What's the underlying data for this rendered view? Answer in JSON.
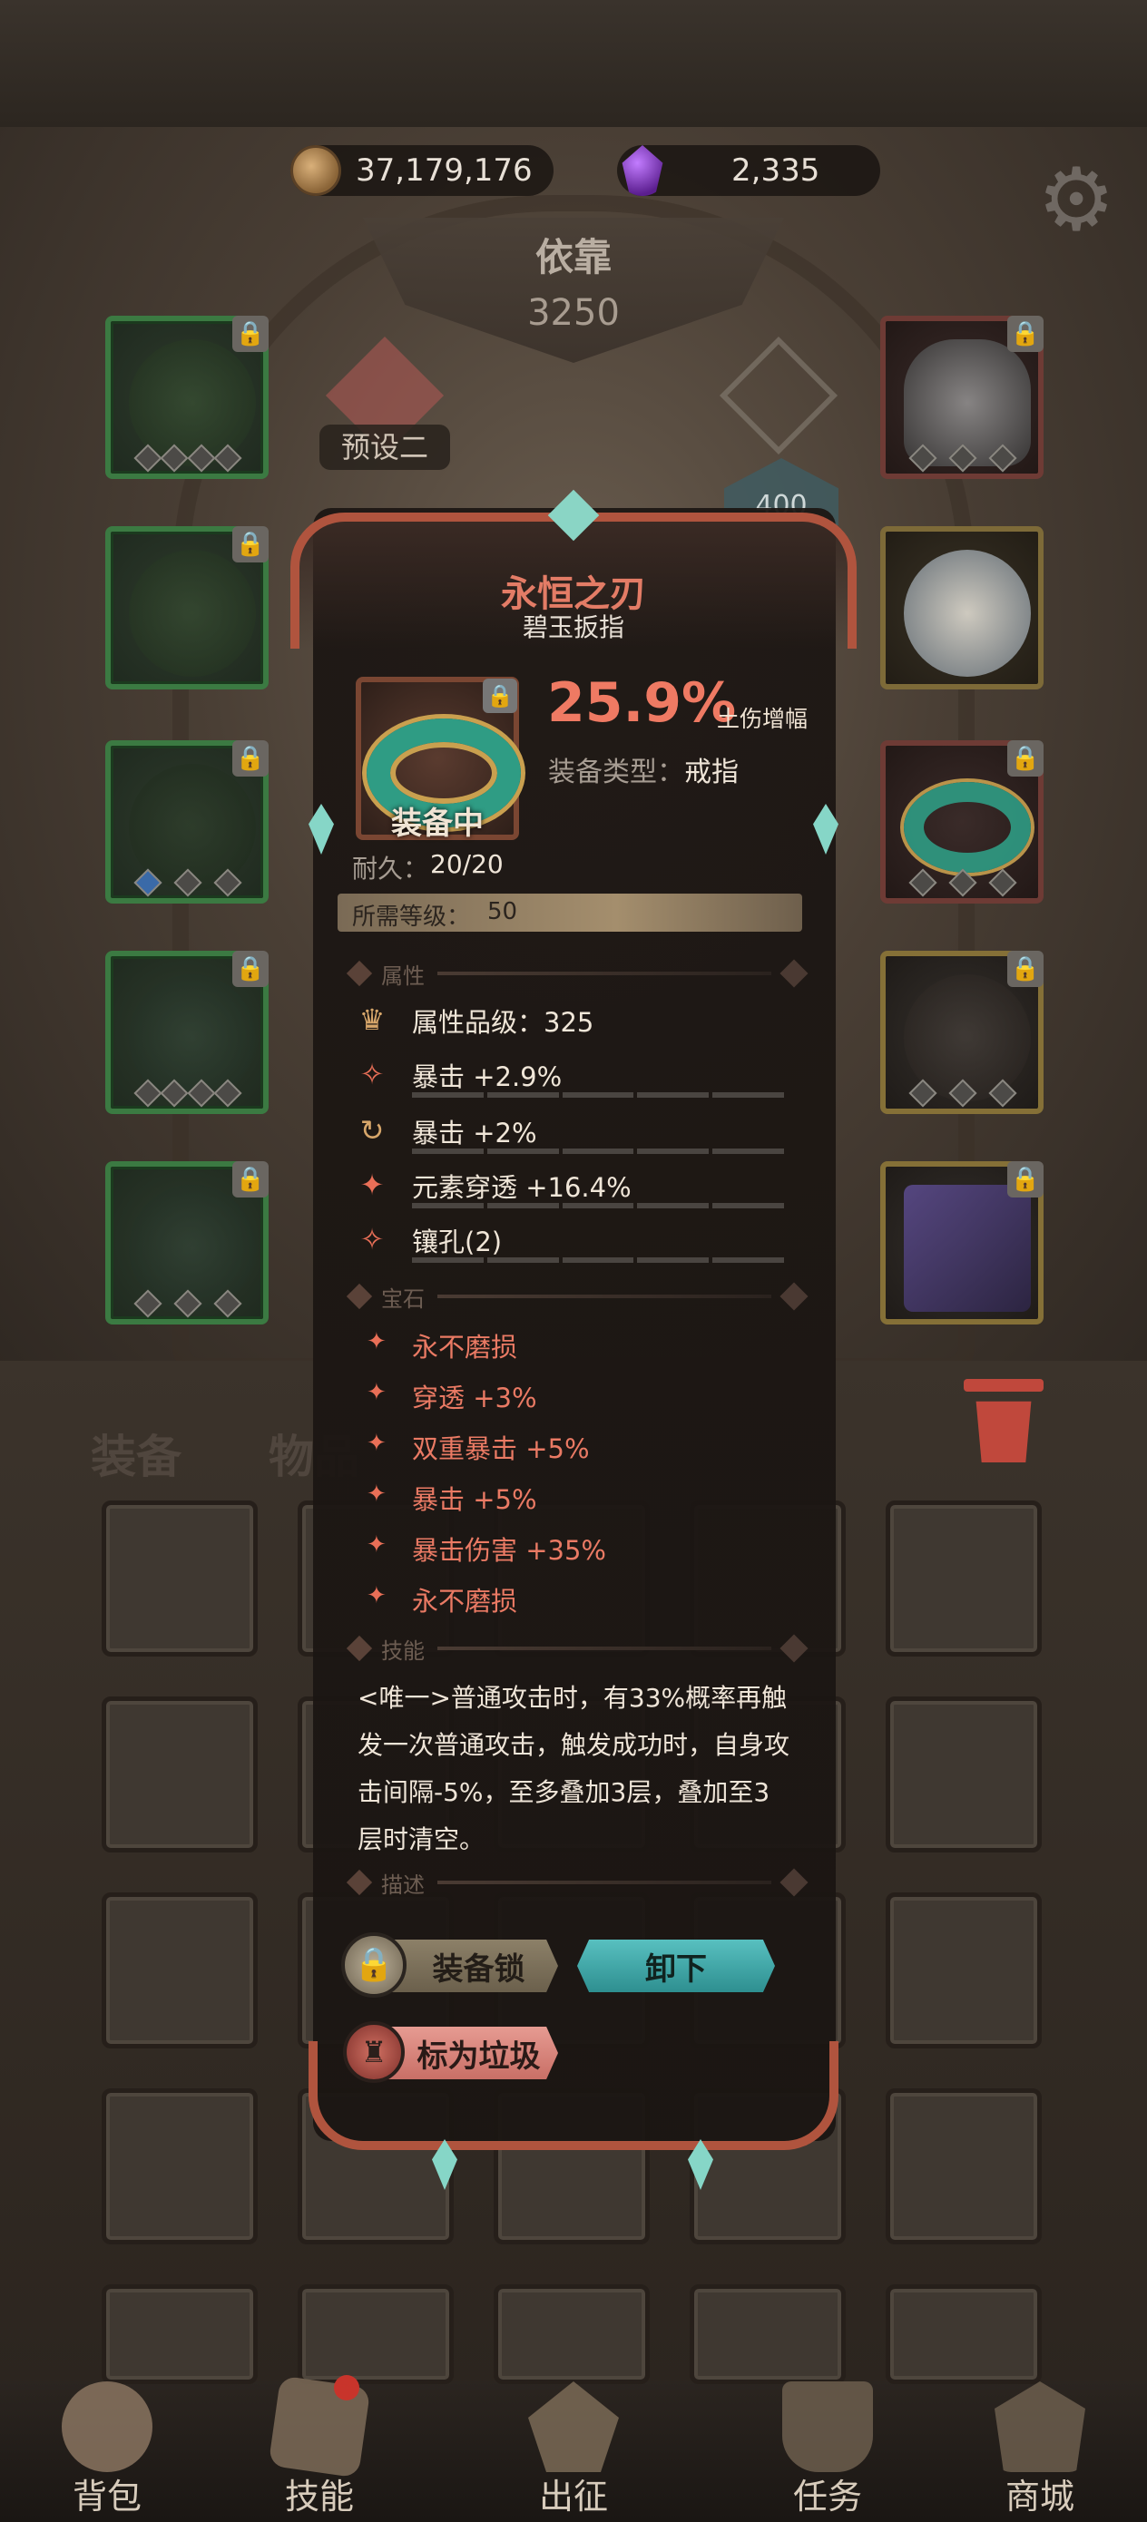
{
  "currency": {
    "gold": "37,179,176",
    "gems": "2,335"
  },
  "loadout": {
    "name": "依靠",
    "power": "3250",
    "preset_label": "预设二",
    "rank": "400"
  },
  "item": {
    "name": "永恒之刃",
    "subname": "碧玉扳指",
    "equipped_label": "装备中",
    "main_stat_value": "25.9%",
    "main_stat_label": "土伤增幅",
    "type_label": "装备类型：",
    "type_value": "戒指",
    "durability_label": "耐久：",
    "durability_value": "20/20",
    "required_level_label": "所需等级：",
    "required_level_value": "50"
  },
  "sections": {
    "attributes": "属性",
    "gems": "宝石",
    "skills": "技能",
    "description": "描述"
  },
  "attributes": [
    {
      "icon": "crown-icon",
      "text": "属性品级：325"
    },
    {
      "icon": "crit-icon",
      "text": "暴击 +2.9%"
    },
    {
      "icon": "cycle-icon",
      "text": "暴击 +2%"
    },
    {
      "icon": "pierce-icon",
      "text": "元素穿透 +16.4%"
    },
    {
      "icon": "socket-icon",
      "text": "镶孔(2)"
    }
  ],
  "gems": [
    "永不磨损",
    "穿透 +3%",
    "双重暴击 +5%",
    "暴击 +5%",
    "暴击伤害 +35%",
    "永不磨损"
  ],
  "skill_text": "<唯一>普通攻击时，有33%概率再触发一次普通攻击，触发成功时，自身攻击间隔-5%，至多叠加3层，叠加至3层时清空。",
  "buttons": {
    "lock": "装备锁",
    "unequip": "卸下",
    "mark_trash": "标为垃圾"
  },
  "inventory_tabs": {
    "equipment": "装备",
    "items": "物品"
  },
  "nav": {
    "backpack": "背包",
    "skills": "技能",
    "expedition": "出征",
    "quests": "任务",
    "shop": "商城"
  },
  "colors": {
    "accent_red": "#ef7a63",
    "unequip_teal": "#3aa5a6",
    "frame": "#b0543e"
  }
}
